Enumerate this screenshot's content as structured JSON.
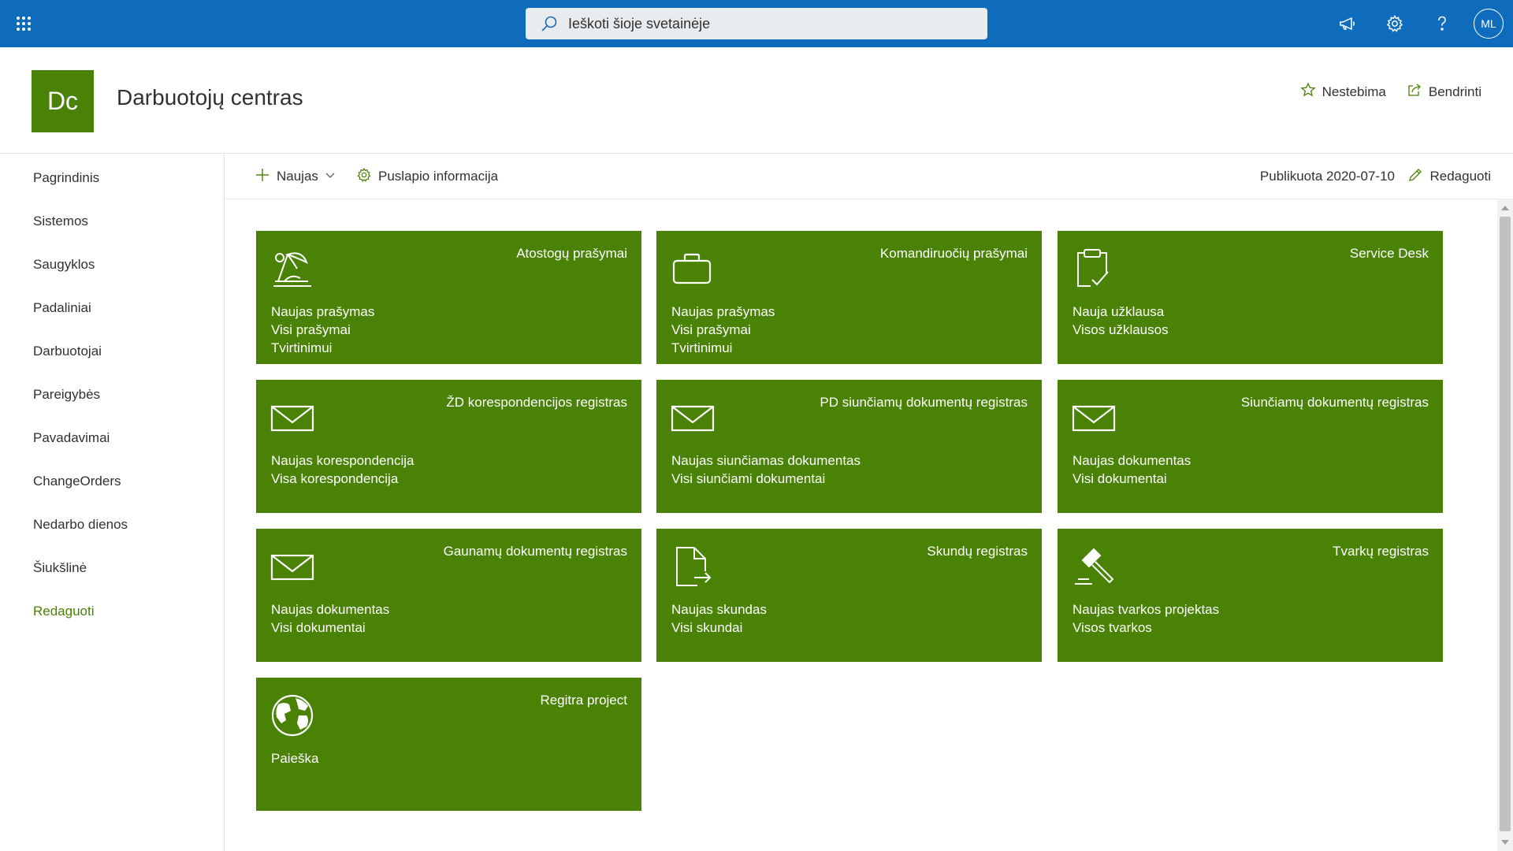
{
  "suite": {
    "search_placeholder": "Ieškoti šioje svetainėje",
    "avatar_initials": "ML"
  },
  "site": {
    "logo_text": "Dc",
    "title": "Darbuotojų centras",
    "follow_label": "Nestebima",
    "share_label": "Bendrinti"
  },
  "nav": {
    "items": [
      "Pagrindinis",
      "Sistemos",
      "Saugyklos",
      "Padaliniai",
      "Darbuotojai",
      "Pareigybės",
      "Pavadavimai",
      "ChangeOrders",
      "Nedarbo dienos",
      "Šiukšlinė"
    ],
    "edit_label": "Redaguoti"
  },
  "commandbar": {
    "new_label": "Naujas",
    "page_info_label": "Puslapio informacija",
    "published_label": "Publikuota 2020-07-10",
    "edit_label": "Redaguoti"
  },
  "tiles": [
    {
      "title": "Atostogų prašymai",
      "icon": "beach-icon",
      "links": [
        "Naujas prašymas",
        "Visi prašymai",
        "Tvirtinimui"
      ]
    },
    {
      "title": "Komandiruočių prašymai",
      "icon": "briefcase-icon",
      "links": [
        "Naujas prašymas",
        "Visi prašymai",
        "Tvirtinimui"
      ]
    },
    {
      "title": "Service Desk",
      "icon": "clipboard-check-icon",
      "links": [
        "Nauja užklausa",
        "Visos užklausos"
      ]
    },
    {
      "title": "ŽD korespondencijos registras",
      "icon": "mail-icon",
      "links": [
        "Naujas korespondencija",
        "Visa korespondencija"
      ]
    },
    {
      "title": "PD siunčiamų dokumentų registras",
      "icon": "mail-icon",
      "links": [
        "Naujas siunčiamas dokumentas",
        "Visi siunčiami dokumentai"
      ]
    },
    {
      "title": "Siunčiamų dokumentų registras",
      "icon": "mail-icon",
      "links": [
        "Naujas dokumentas",
        "Visi dokumentai"
      ]
    },
    {
      "title": "Gaunamų dokumentų registras",
      "icon": "mail-icon",
      "links": [
        "Naujas dokumentas",
        "Visi dokumentai"
      ]
    },
    {
      "title": "Skundų registras",
      "icon": "document-arrow-icon",
      "links": [
        "Naujas skundas",
        "Visi skundai"
      ]
    },
    {
      "title": "Tvarkų registras",
      "icon": "gavel-icon",
      "links": [
        "Naujas tvarkos projektas",
        "Visos tvarkos"
      ]
    },
    {
      "title": "Regitra project",
      "icon": "globe-icon",
      "links": [
        "Paieška"
      ]
    }
  ],
  "colors": {
    "suite_bar": "#0f6cbd",
    "tile": "#498205",
    "site_logo": "#498205",
    "nav_edit": "#498205"
  }
}
